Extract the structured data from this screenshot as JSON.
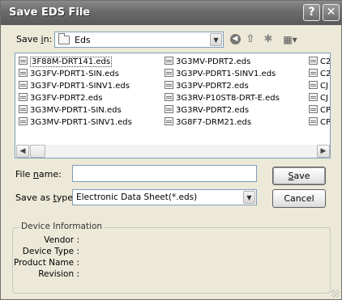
{
  "window": {
    "title": "Save EDS File",
    "help_label": "?",
    "close_label": "✕"
  },
  "save_in": {
    "label_prefix": "Save ",
    "label_accel": "i",
    "label_suffix": "n:",
    "value": "Eds",
    "icons": [
      "folder-icon",
      "chevron-down-icon",
      "back-icon",
      "up-folder-icon",
      "new-folder-icon",
      "views-menu-icon"
    ]
  },
  "files": {
    "col1": [
      "3F88M-DRT141.eds",
      "3G3FV-PDRT1-SIN.eds",
      "3G3FV-PDRT1-SINV1.eds",
      "3G3FV-PDRT2.eds",
      "3G3MV-PDRT1-SIN.eds",
      "3G3MV-PDRT1-SINV1.eds"
    ],
    "col2": [
      "3G3MV-PDRT2.eds",
      "3G3PV-PDRT1-SINV1.eds",
      "3G3PV-PDRT2.eds",
      "3G3RV-P10ST8-DRT-E.eds",
      "3G3RV-PDRT2.eds",
      "3G8F7-DRM21.eds"
    ],
    "col3": [
      "C2",
      "C2",
      "CJ",
      "CJ",
      "CP",
      "CP"
    ],
    "selected": "3F88M-DRT141.eds"
  },
  "scrollbar": {
    "left_arrow": "◀",
    "right_arrow": "▶"
  },
  "filename": {
    "label_prefix": "File ",
    "label_accel": "n",
    "label_suffix": "ame:",
    "value": ""
  },
  "save_as_type": {
    "label_prefix": "Save as ",
    "label_accel": "t",
    "label_suffix": "ype:",
    "value": "Electronic Data Sheet(*.eds)"
  },
  "buttons": {
    "save_accel": "S",
    "save_rest": "ave",
    "cancel": "Cancel"
  },
  "device_info": {
    "title": "Device Information",
    "vendor_label": "Vendor :",
    "device_type_label": "Device Type :",
    "product_name_label": "Product Name :",
    "revision_label": "Revision :"
  }
}
